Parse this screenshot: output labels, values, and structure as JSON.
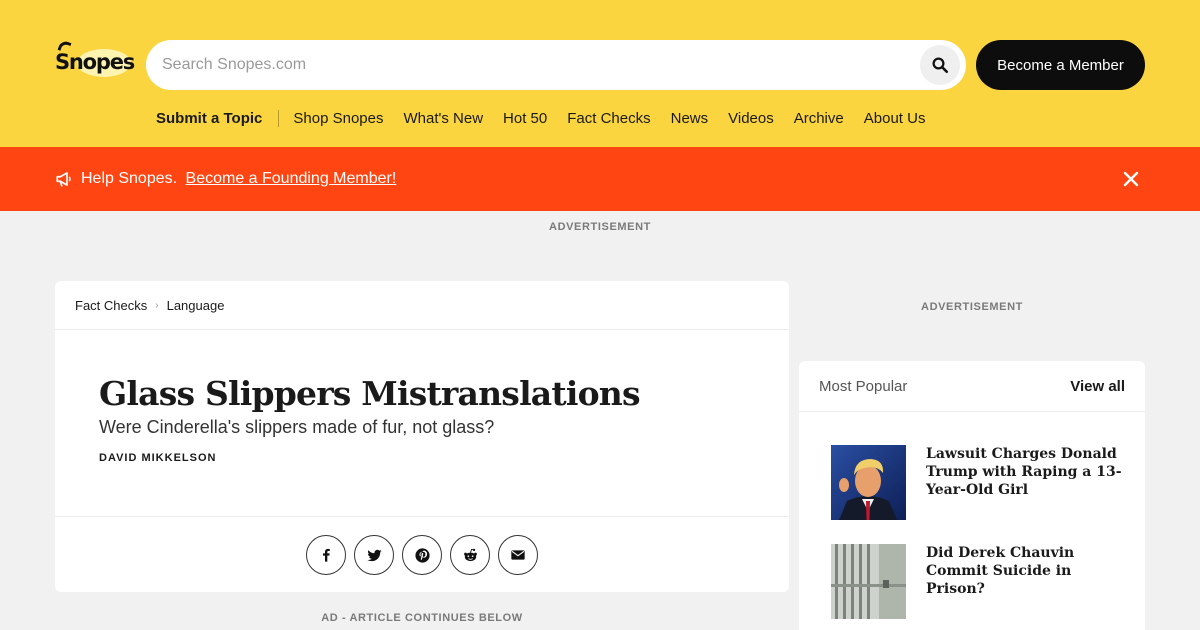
{
  "header": {
    "logo_text": "Snopes",
    "search_placeholder": "Search Snopes.com",
    "member_button": "Become a Member",
    "nav": [
      "Submit a Topic",
      "Shop Snopes",
      "What's New",
      "Hot 50",
      "Fact Checks",
      "News",
      "Videos",
      "Archive",
      "About Us"
    ]
  },
  "promo": {
    "text": "Help Snopes.",
    "link": "Become a Founding Member!"
  },
  "ads": {
    "top": "ADVERTISEMENT",
    "sidebar": "ADVERTISEMENT",
    "below": "AD - ARTICLE CONTINUES BELOW"
  },
  "article": {
    "breadcrumb": [
      "Fact Checks",
      "Language"
    ],
    "title": "Glass Slippers Mistranslations",
    "subtitle": "Were Cinderella's slippers made of fur, not glass?",
    "author": "DAVID MIKKELSON",
    "share_icons": [
      "facebook-icon",
      "twitter-icon",
      "pinterest-icon",
      "reddit-icon",
      "email-icon"
    ]
  },
  "sidebar": {
    "heading": "Most Popular",
    "view_all": "View all",
    "items": [
      {
        "title": "Lawsuit Charges Donald Trump with Raping a 13-Year-Old Girl"
      },
      {
        "title": "Did Derek Chauvin Commit Suicide in Prison?"
      }
    ]
  },
  "colors": {
    "header_bg": "#fbd53f",
    "promo_bg": "#ff4612",
    "page_bg": "#f1f1f1"
  }
}
